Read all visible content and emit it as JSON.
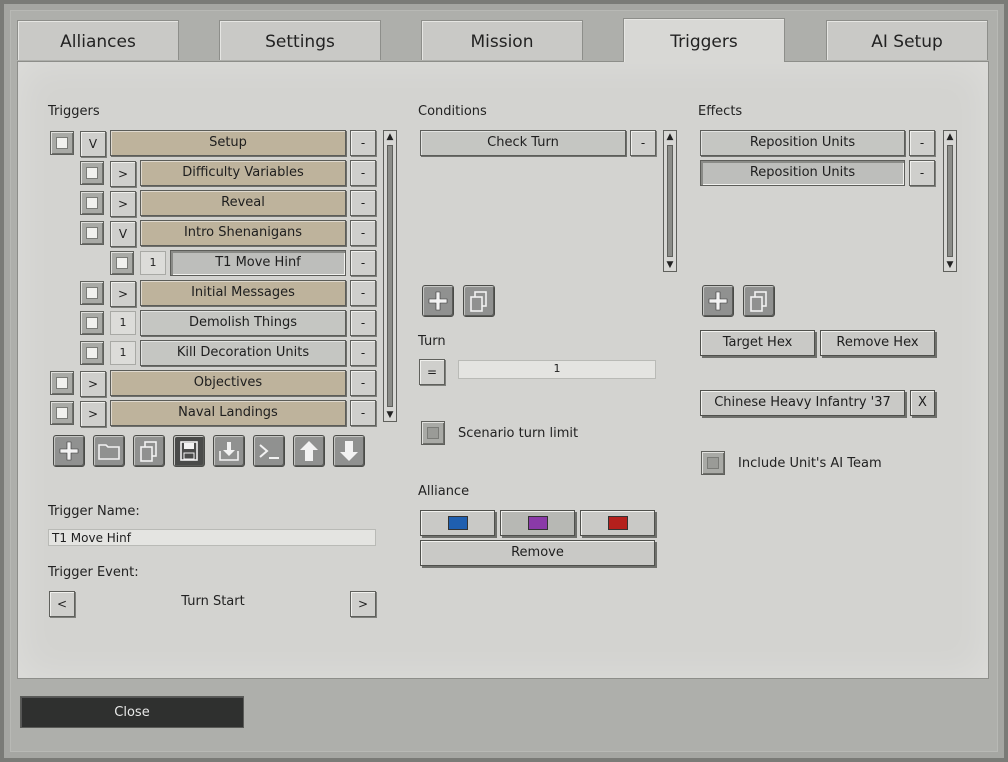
{
  "tabs": [
    {
      "label": "Alliances",
      "active": false
    },
    {
      "label": "Settings",
      "active": false
    },
    {
      "label": "Mission",
      "active": false
    },
    {
      "label": "Triggers",
      "active": true
    },
    {
      "label": "AI Setup",
      "active": false
    }
  ],
  "triggers": {
    "heading": "Triggers",
    "items": [
      {
        "expander": "V",
        "label": "Setup",
        "remove": "-"
      },
      {
        "expander": ">",
        "label": "Difficulty Variables",
        "remove": "-"
      },
      {
        "expander": ">",
        "label": "Reveal",
        "remove": "-"
      },
      {
        "expander": "V",
        "label": "Intro Shenanigans",
        "remove": "-"
      },
      {
        "expander": "1",
        "label": "T1 Move Hinf",
        "remove": "-"
      },
      {
        "expander": ">",
        "label": "Initial Messages",
        "remove": "-"
      },
      {
        "expander": "1",
        "label": "Demolish Things",
        "remove": "-"
      },
      {
        "expander": "1",
        "label": "Kill Decoration Units",
        "remove": "-"
      },
      {
        "expander": ">",
        "label": "Objectives",
        "remove": "-"
      },
      {
        "expander": ">",
        "label": "Naval Landings",
        "remove": "-"
      }
    ],
    "toolbar": [
      "add-icon",
      "folder-icon",
      "copy-icon",
      "save-icon",
      "import-icon",
      "console-icon",
      "arrow-up-icon",
      "arrow-down-icon"
    ],
    "name_label": "Trigger Name:",
    "name_value": "T1 Move Hinf",
    "event_label": "Trigger Event:",
    "event_prev": "<",
    "event_value": "Turn Start",
    "event_next": ">"
  },
  "conditions": {
    "heading": "Conditions",
    "items": [
      {
        "label": "Check Turn",
        "remove": "-"
      }
    ],
    "turn_label": "Turn",
    "turn_operator": "=",
    "turn_value": "1",
    "scenario_limit_label": "Scenario turn limit",
    "alliance_label": "Alliance",
    "alliance_colors": [
      "#1f5fb0",
      "#8a3aa8",
      "#b4201c"
    ],
    "remove_label": "Remove"
  },
  "effects": {
    "heading": "Effects",
    "items": [
      {
        "label": "Reposition Units",
        "remove": "-"
      },
      {
        "label": "Reposition Units",
        "remove": "-"
      }
    ],
    "target_hex_label": "Target Hex",
    "remove_hex_label": "Remove Hex",
    "unit_label": "Chinese Heavy Infantry '37",
    "unit_clear": "X",
    "include_ai_label": "Include Unit's AI Team"
  },
  "scroll_arrows": {
    "up": "▲",
    "down": "▼"
  },
  "footer": {
    "close_label": "Close"
  }
}
